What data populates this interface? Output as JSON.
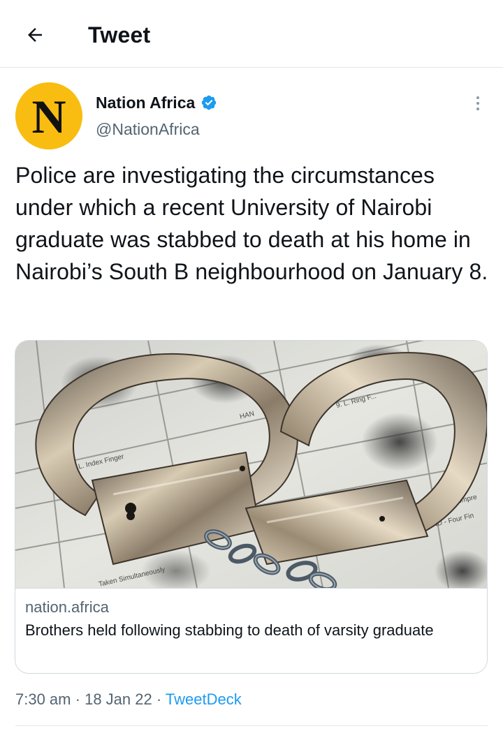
{
  "header": {
    "title": "Tweet",
    "back_icon": "arrow-left-icon"
  },
  "author": {
    "avatar_letter": "N",
    "avatar_color": "#f9bd12",
    "name": "Nation Africa",
    "handle": "@NationAfrica",
    "verified_icon": "verified-badge-icon",
    "verified_color": "#1d9bf0",
    "more_icon": "more-vertical-icon"
  },
  "tweet": {
    "text": "Police are investigating the circumstances under which a recent University of Nairobi graduate was stabbed to death at his home in Nairobi’s South B neighbourhood on January 8."
  },
  "card": {
    "image_text": {
      "index_finger": "7. L. Index Finger",
      "ring_finger": "9. L. Ring F...",
      "taken": "Taken Simultaneously",
      "impression": "...n Impre",
      "four_fingers": "...AND - Four Fin",
      "hand": "HAN"
    },
    "domain": "nation.africa",
    "title": "Brothers held following stabbing to death of varsity graduate"
  },
  "meta": {
    "time": "7:30 am",
    "date": "18 Jan 22",
    "separator": "·",
    "source": "TweetDeck",
    "source_color": "#1d9bf0"
  }
}
